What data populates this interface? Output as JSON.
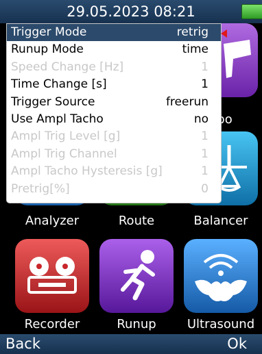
{
  "status_bar": {
    "datetime": "29.05.2023 08:21",
    "battery_color": "#5fcf48"
  },
  "menu": {
    "items": [
      {
        "label": "Trigger Mode",
        "value": "retrig",
        "state": "selected"
      },
      {
        "label": "Runup Mode",
        "value": "time",
        "state": "enabled"
      },
      {
        "label": "Speed Change [Hz]",
        "value": "1",
        "state": "disabled"
      },
      {
        "label": "Time Change [s]",
        "value": "1",
        "state": "enabled"
      },
      {
        "label": "Trigger Source",
        "value": "freerun",
        "state": "enabled"
      },
      {
        "label": "Use Ampl Tacho",
        "value": "no",
        "state": "enabled"
      },
      {
        "label": "Ampl Trig Level [g]",
        "value": "1",
        "state": "disabled"
      },
      {
        "label": "Ampl Trig Channel",
        "value": "1",
        "state": "disabled"
      },
      {
        "label": "Ampl Tacho Hysteresis [g]",
        "value": "1",
        "state": "disabled"
      },
      {
        "label": "Pretrig[%]",
        "value": "0",
        "state": "disabled"
      }
    ],
    "selected_color": "#2c4a6b",
    "disabled_text_color": "#c8c8c8"
  },
  "tiles": {
    "robo": {
      "label": "obo",
      "color": "#8a3bc2"
    },
    "analyzer": {
      "label": "Analyzer",
      "color": "#2d8bd6"
    },
    "route": {
      "label": "Route",
      "color": "#3a9a2a"
    },
    "balancer": {
      "label": "Balancer",
      "color": "#1ea0d8"
    },
    "recorder": {
      "label": "Recorder",
      "color": "#c8262a"
    },
    "runup": {
      "label": "Runup",
      "color": "#7b2fc0"
    },
    "ultrasound": {
      "label": "Ultrasound",
      "color": "#2f7fd8"
    }
  },
  "footer": {
    "back_label": "Back",
    "ok_label": "Ok"
  }
}
